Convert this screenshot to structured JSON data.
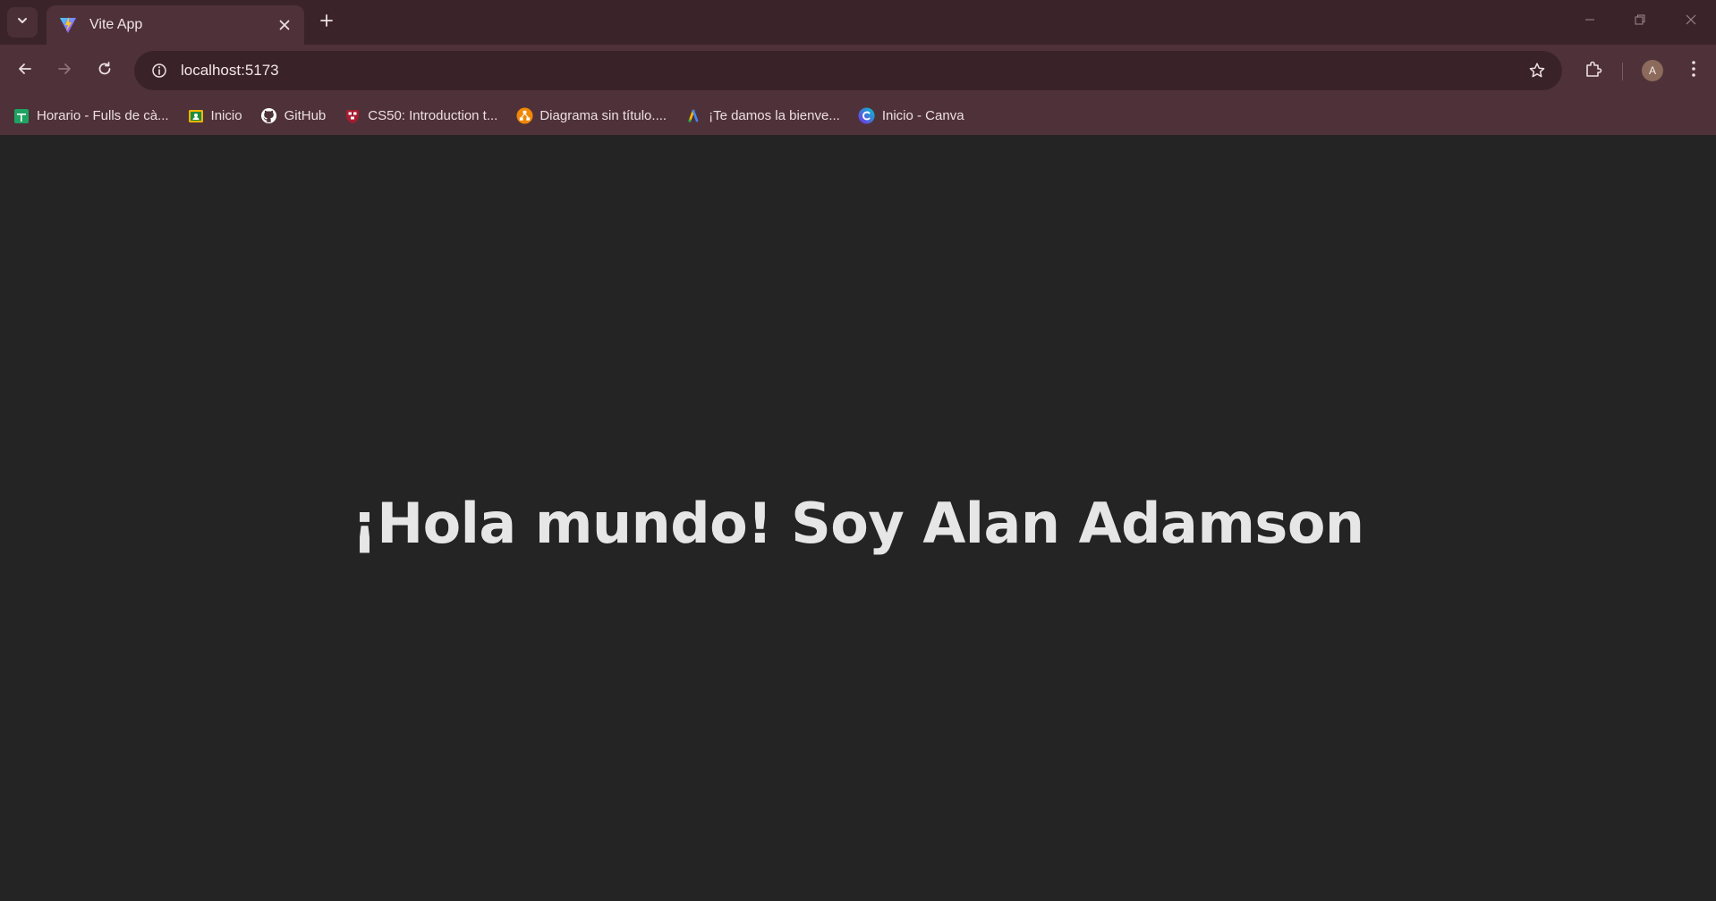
{
  "window": {
    "tab": {
      "title": "Vite App",
      "favicon": "vite-logo-icon"
    },
    "controls": [
      "minimize-icon",
      "restore-icon",
      "close-icon"
    ]
  },
  "toolbar": {
    "url": "localhost:5173"
  },
  "bookmarks": [
    {
      "label": "Horario - Fulls de cà...",
      "icon": "sheets-icon",
      "color": "#1ea362"
    },
    {
      "label": "Inicio",
      "icon": "classroom-icon",
      "color": "#f5b400"
    },
    {
      "label": "GitHub",
      "icon": "github-icon",
      "color": "#ffffff"
    },
    {
      "label": "CS50: Introduction t...",
      "icon": "harvard-icon",
      "color": "#a51c30"
    },
    {
      "label": "Diagrama sin título....",
      "icon": "drawio-icon",
      "color": "#f08705"
    },
    {
      "label": "¡Te damos la bienve...",
      "icon": "google-ads-icon",
      "color": "#4285f4"
    },
    {
      "label": "Inicio - Canva",
      "icon": "canva-icon",
      "color": "#2fb5e8"
    }
  ],
  "profile": {
    "initial": "A"
  },
  "page": {
    "heading": "¡Hola mundo! Soy Alan Adamson"
  }
}
